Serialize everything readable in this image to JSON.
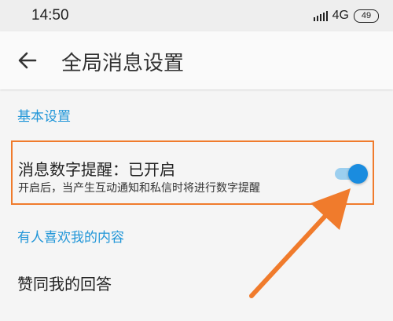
{
  "status_bar": {
    "time": "14:50",
    "network": "4G",
    "battery_level": "49"
  },
  "header": {
    "back_icon": "arrow-left-icon",
    "title": "全局消息设置"
  },
  "sections": {
    "basic": {
      "heading": "基本设置",
      "setting": {
        "title": "消息数字提醒：已开启",
        "description": "开启后，当产生互动通知和私信时将进行数字提醒",
        "enabled": true
      }
    },
    "liked": {
      "heading": "有人喜欢我的内容",
      "items": [
        "赞同我的回答"
      ]
    }
  },
  "colors": {
    "accent": "#2196d8",
    "highlight_border": "#f07b2c",
    "arrow": "#f07b2c",
    "toggle_thumb": "#1a8cdf",
    "toggle_track": "#9ccfef"
  }
}
